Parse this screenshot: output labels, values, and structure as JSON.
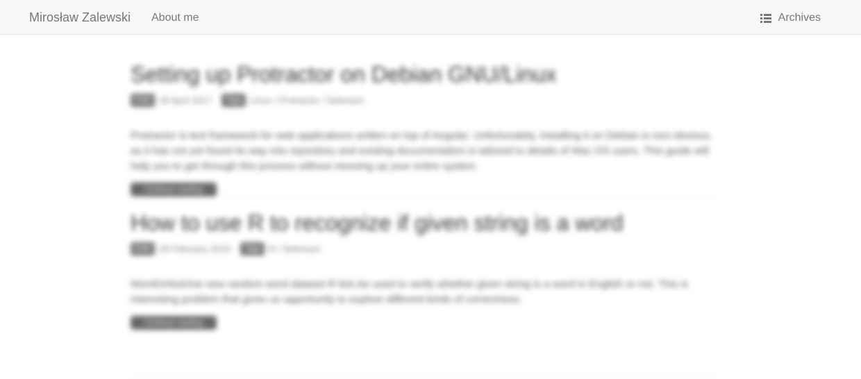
{
  "navbar": {
    "brand": "Mirosław Zalewski",
    "about": "About me",
    "archives": "Archives",
    "archives_icon": "list-icon"
  },
  "posts": [
    {
      "title": "Setting up Protractor on Debian GNU/Linux",
      "date_label": "Date",
      "date": "26 April 2017",
      "tags_label": "Tags",
      "tags": "Linux / Protractor / Selenium",
      "excerpt": "Protractor is test framework for web applications written on top of Angular. Unfortunately, installing it on Debian is non-obvious, as it has not yet found its way into repository and existing documentation is tailored to details of Mac OS users. This guide will help you to get through this process without messing up your entire system.",
      "read_more": "Continue reading"
    },
    {
      "title": "How to use R to recognize if given string is a word",
      "date_label": "Date",
      "date": "26 February 2016",
      "tags_label": "Tags",
      "tags": "R / Selenium",
      "excerpt": "WordOrNotOne new random word dataset R lets be used to verify whether given string is a word in English or not. This is interesting problem that gives us opportunity to explore different kinds of correctness.",
      "read_more": "Continue reading"
    }
  ]
}
